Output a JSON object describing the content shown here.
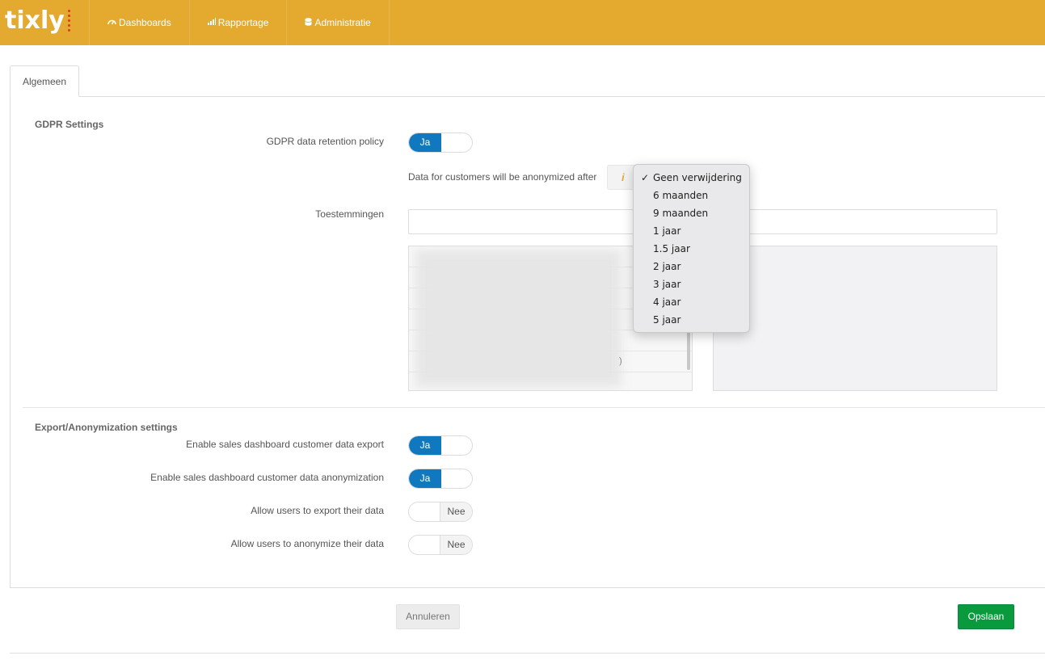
{
  "app": {
    "logo_text": "tixly",
    "brand_color": "#e3aa2f",
    "primary_color": "#0f78be",
    "success_color": "#0a9a3e"
  },
  "nav": [
    {
      "label": "Dashboards",
      "icon": "gauge-icon"
    },
    {
      "label": "Rapportage",
      "icon": "bar-chart-icon"
    },
    {
      "label": "Administratie",
      "icon": "database-icon"
    }
  ],
  "tabs": [
    {
      "label": "Algemeen",
      "active": true
    }
  ],
  "gdpr": {
    "title": "GDPR Settings",
    "retention_label": "GDPR data retention policy",
    "retention_toggle": {
      "state": "on",
      "on_label": "Ja"
    },
    "anonymized_after_label": "Data for customers will be anonymized after",
    "info_glyph": "i",
    "consents_label": "Toestemmingen",
    "list_fragment": ")"
  },
  "retention_dropdown": {
    "selected": "Geen verwijdering",
    "check_glyph": "✓",
    "options": [
      "Geen verwijdering",
      "6 maanden",
      "9 maanden",
      "1 jaar",
      "1.5 jaar",
      "2 jaar",
      "3 jaar",
      "4 jaar",
      "5 jaar"
    ]
  },
  "export": {
    "title": "Export/Anonymization settings",
    "items": [
      {
        "label": "Enable sales dashboard customer data export",
        "state": "on",
        "toggle_label": "Ja"
      },
      {
        "label": "Enable sales dashboard customer data anonymization",
        "state": "on",
        "toggle_label": "Ja"
      },
      {
        "label": "Allow users to export their data",
        "state": "off",
        "toggle_label": "Nee"
      },
      {
        "label": "Allow users to anonymize their data",
        "state": "off",
        "toggle_label": "Nee"
      }
    ]
  },
  "actions": {
    "cancel_label": "Annuleren",
    "save_label": "Opslaan"
  }
}
